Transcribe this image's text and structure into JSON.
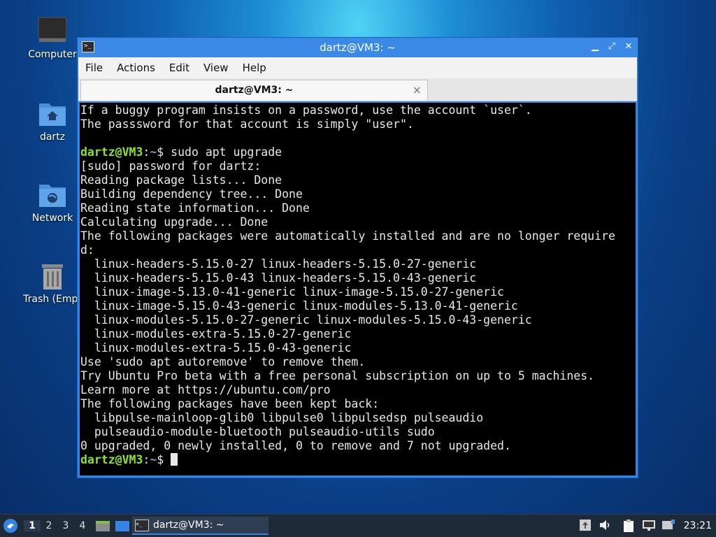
{
  "desktop": {
    "icons": [
      {
        "label": "Computer"
      },
      {
        "label": "dartz"
      },
      {
        "label": "Network"
      },
      {
        "label": "Trash (Empt"
      }
    ]
  },
  "window": {
    "title": "dartz@VM3: ~",
    "menu": [
      "File",
      "Actions",
      "Edit",
      "View",
      "Help"
    ],
    "tab_label": "dartz@VM3: ~",
    "tab_close": "×"
  },
  "terminal": {
    "lines": [
      {
        "text": "If a buggy program insists on a password, use the account `user`."
      },
      {
        "text": "The passsword for that account is simply \"user\"."
      },
      {
        "text": ""
      },
      {
        "user": "dartz@VM3",
        "path": "~",
        "cmd": "$ sudo apt upgrade"
      },
      {
        "text": "[sudo] password for dartz:"
      },
      {
        "text": "Reading package lists... Done"
      },
      {
        "text": "Building dependency tree... Done"
      },
      {
        "text": "Reading state information... Done"
      },
      {
        "text": "Calculating upgrade... Done"
      },
      {
        "text": "The following packages were automatically installed and are no longer require"
      },
      {
        "text": "d:"
      },
      {
        "text": "  linux-headers-5.15.0-27 linux-headers-5.15.0-27-generic"
      },
      {
        "text": "  linux-headers-5.15.0-43 linux-headers-5.15.0-43-generic"
      },
      {
        "text": "  linux-image-5.13.0-41-generic linux-image-5.15.0-27-generic"
      },
      {
        "text": "  linux-image-5.15.0-43-generic linux-modules-5.13.0-41-generic"
      },
      {
        "text": "  linux-modules-5.15.0-27-generic linux-modules-5.15.0-43-generic"
      },
      {
        "text": "  linux-modules-extra-5.15.0-27-generic"
      },
      {
        "text": "  linux-modules-extra-5.15.0-43-generic"
      },
      {
        "text": "Use 'sudo apt autoremove' to remove them."
      },
      {
        "text": "Try Ubuntu Pro beta with a free personal subscription on up to 5 machines."
      },
      {
        "text": "Learn more at https://ubuntu.com/pro"
      },
      {
        "text": "The following packages have been kept back:"
      },
      {
        "text": "  libpulse-mainloop-glib0 libpulse0 libpulsedsp pulseaudio"
      },
      {
        "text": "  pulseaudio-module-bluetooth pulseaudio-utils sudo"
      },
      {
        "text": "0 upgraded, 0 newly installed, 0 to remove and 7 not upgraded."
      },
      {
        "user": "dartz@VM3",
        "path": "~",
        "cmd": "$ ",
        "cursor": true
      }
    ]
  },
  "taskbar": {
    "workspaces": [
      "1",
      "2",
      "3",
      "4"
    ],
    "active_workspace": "1",
    "task_label": "dartz@VM3: ~",
    "clock": "23:21"
  },
  "colors": {
    "prompt_user": "#8ae234",
    "prompt_path": "#729fcf",
    "window_border": "#3584e4"
  }
}
